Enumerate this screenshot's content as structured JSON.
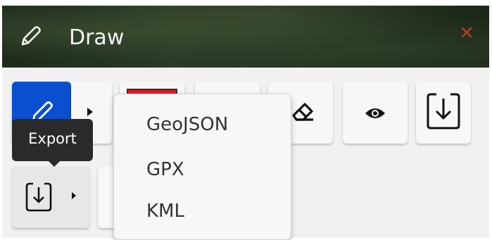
{
  "header": {
    "title": "Draw",
    "icon": "pencil-icon",
    "close_icon": "close-icon",
    "close_color": "#c0392b"
  },
  "toolbar": {
    "row1": [
      {
        "name": "draw-tool",
        "icon": "pencil-icon",
        "active": true,
        "color": "#0a4fcf"
      },
      {
        "name": "color-picker",
        "icon": "color-swatch",
        "color": "#e01b22"
      },
      {
        "name": "blank-tool",
        "icon": ""
      },
      {
        "name": "erase-tool",
        "icon": "eraser-icon"
      },
      {
        "name": "visibility-tool",
        "icon": "eye-icon"
      },
      {
        "name": "import-tool",
        "icon": "download-box-icon"
      }
    ],
    "row2": [
      {
        "name": "export-tool",
        "icon": "download-box-icon",
        "has_dropdown": true
      }
    ]
  },
  "tooltip": {
    "text": "Export"
  },
  "export_menu": {
    "items": [
      "GeoJSON",
      "GPX",
      "KML"
    ]
  }
}
